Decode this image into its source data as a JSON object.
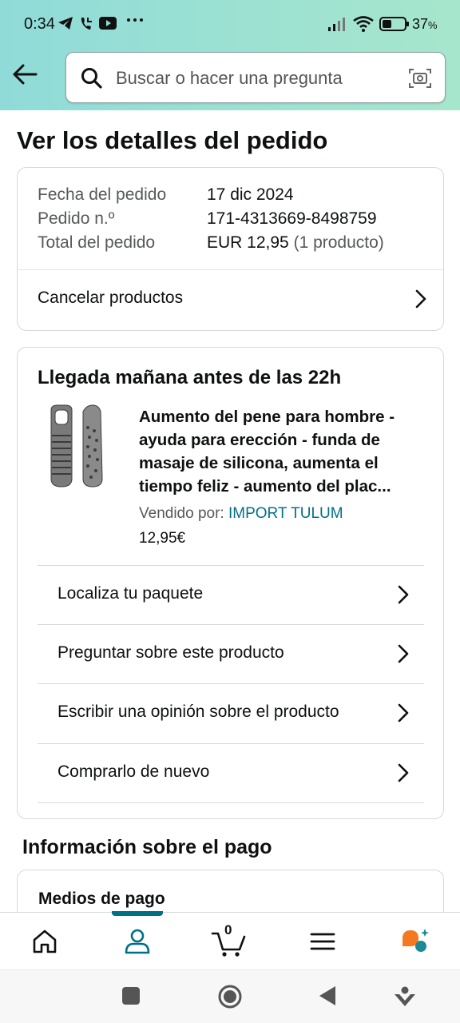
{
  "status_bar": {
    "time": "0:34",
    "battery_percent": "37",
    "battery_unit": "%",
    "icons": [
      "telegram-icon",
      "missed-call-icon",
      "youtube-icon",
      "more-dots-icon",
      "signal-icon",
      "wifi-icon",
      "battery-icon"
    ]
  },
  "header": {
    "back_icon": "arrow-left-icon",
    "search_placeholder": "Buscar o hacer una pregunta",
    "search_icon": "search-icon",
    "camera_icon": "camera-scan-icon"
  },
  "page": {
    "title": "Ver los detalles del pedido"
  },
  "order_summary": {
    "rows": [
      {
        "label": "Fecha del pedido",
        "value": "17 dic 2024",
        "extra": ""
      },
      {
        "label": "Pedido n.º",
        "value": "171-4313669-8498759",
        "extra": ""
      },
      {
        "label": "Total del pedido",
        "value": "EUR 12,95",
        "extra": "(1 producto)"
      }
    ],
    "cancel_label": "Cancelar productos"
  },
  "shipment": {
    "heading": "Llegada mañana antes de las 22h",
    "product": {
      "title": "Aumento del pene para hombre - ayuda para erección - funda de masaje de silicona, aumenta el tiempo feliz - aumento del plac...",
      "sold_by_label": "Vendido por:",
      "seller": "IMPORT TULUM",
      "price": "12,95€"
    },
    "actions": [
      {
        "label": "Localiza tu paquete"
      },
      {
        "label": "Preguntar sobre este producto"
      },
      {
        "label": "Escribir una opinión sobre el producto"
      },
      {
        "label": "Comprarlo de nuevo"
      }
    ]
  },
  "payment": {
    "heading": "Información sobre el pago",
    "sub_heading": "Medios de pago"
  },
  "bottom_nav": {
    "items": [
      "home-icon",
      "account-icon",
      "cart-icon",
      "menu-icon",
      "rufus-assistant-icon"
    ],
    "active": "account-icon",
    "cart_count": "0"
  },
  "colors": {
    "header_gradient_start": "#90dbd9",
    "header_gradient_end": "#a6e6cc",
    "link": "#007185",
    "text": "#0f1111",
    "muted": "#565959",
    "rufus_orange": "#f47a20",
    "rufus_teal": "#1c8a96"
  }
}
